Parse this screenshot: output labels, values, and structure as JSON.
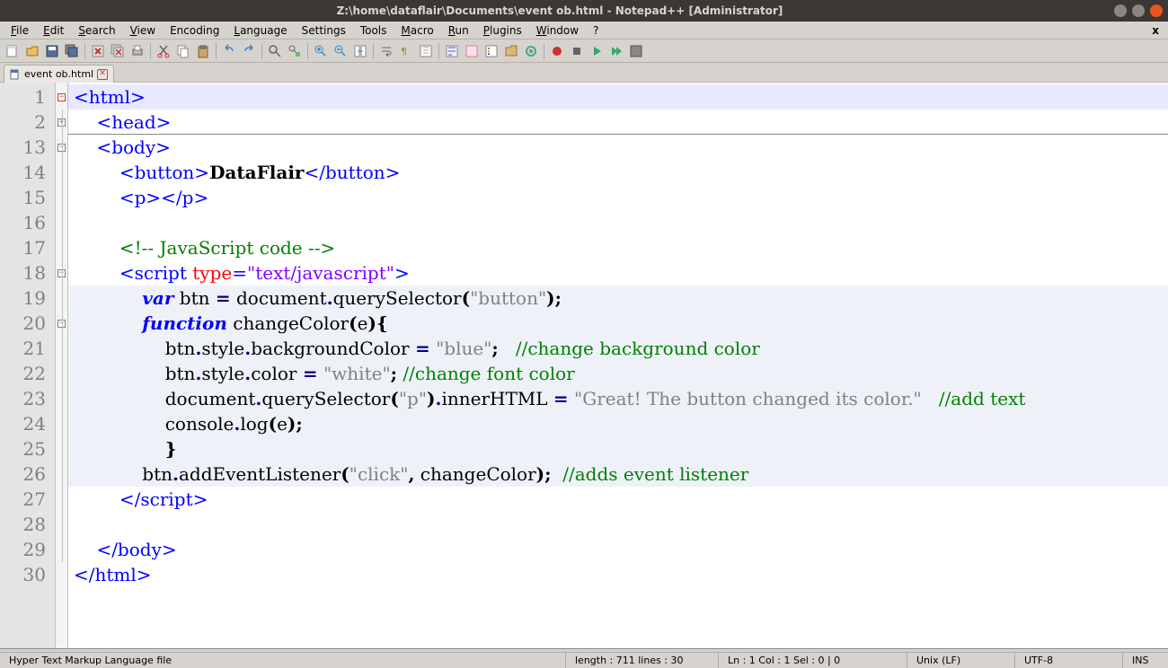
{
  "window": {
    "title": "Z:\\home\\dataflair\\Documents\\event ob.html - Notepad++ [Administrator]"
  },
  "menus": [
    "File",
    "Edit",
    "Search",
    "View",
    "Encoding",
    "Language",
    "Settings",
    "Tools",
    "Macro",
    "Run",
    "Plugins",
    "Window",
    "?"
  ],
  "menubar_close": "x",
  "tab": {
    "label": "event ob.html"
  },
  "line_numbers": [
    "1",
    "2",
    "13",
    "14",
    "15",
    "16",
    "17",
    "18",
    "19",
    "20",
    "21",
    "22",
    "23",
    "24",
    "25",
    "26",
    "27",
    "28",
    "29",
    "30"
  ],
  "fold_markers": [
    "-",
    "+",
    "-",
    "",
    "",
    "",
    "",
    "-",
    "",
    "-",
    "",
    "",
    "",
    "",
    "",
    "",
    "",
    "",
    "",
    ""
  ],
  "code": {
    "l1": {
      "indent": "",
      "t": [
        {
          "c": "tag",
          "v": "<html>"
        }
      ]
    },
    "l2": {
      "indent": "    ",
      "t": [
        {
          "c": "tag",
          "v": "<head>"
        }
      ]
    },
    "l3": {
      "indent": "    ",
      "t": [
        {
          "c": "tag",
          "v": "<body>"
        }
      ]
    },
    "l4": {
      "indent": "        ",
      "t": [
        {
          "c": "tag",
          "v": "<button>"
        },
        {
          "c": "bold",
          "v": "DataFlair"
        },
        {
          "c": "tag",
          "v": "</button>"
        }
      ]
    },
    "l5": {
      "indent": "        ",
      "t": [
        {
          "c": "tag",
          "v": "<p></p>"
        }
      ]
    },
    "l6": {
      "indent": "",
      "t": []
    },
    "l7": {
      "indent": "        ",
      "t": [
        {
          "c": "comment",
          "v": "<!-- JavaScript code -->"
        }
      ]
    },
    "l8": {
      "indent": "        ",
      "t": [
        {
          "c": "tag",
          "v": "<script "
        },
        {
          "c": "attr",
          "v": "type"
        },
        {
          "c": "tag",
          "v": "="
        },
        {
          "c": "str",
          "v": "\"text/javascript\""
        },
        {
          "c": "tag",
          "v": ">"
        }
      ]
    },
    "l9": {
      "indent": "            ",
      "t": [
        {
          "c": "kw",
          "v": "var"
        },
        {
          "c": "ident",
          "v": " btn "
        },
        {
          "c": "punct",
          "v": "="
        },
        {
          "c": "ident",
          "v": " document"
        },
        {
          "c": "punct",
          "v": "."
        },
        {
          "c": "ident",
          "v": "querySelector"
        },
        {
          "c": "paren",
          "v": "("
        },
        {
          "c": "strgray",
          "v": "\"button\""
        },
        {
          "c": "paren",
          "v": ");"
        }
      ]
    },
    "l10": {
      "indent": "            ",
      "t": [
        {
          "c": "kw",
          "v": "function"
        },
        {
          "c": "ident",
          "v": " changeColor"
        },
        {
          "c": "paren",
          "v": "("
        },
        {
          "c": "ident",
          "v": "e"
        },
        {
          "c": "paren",
          "v": "){"
        }
      ]
    },
    "l11": {
      "indent": "                ",
      "t": [
        {
          "c": "ident",
          "v": "btn"
        },
        {
          "c": "punct",
          "v": "."
        },
        {
          "c": "ident",
          "v": "style"
        },
        {
          "c": "punct",
          "v": "."
        },
        {
          "c": "ident",
          "v": "backgroundColor "
        },
        {
          "c": "punct",
          "v": "="
        },
        {
          "c": "ident",
          "v": " "
        },
        {
          "c": "strgray",
          "v": "\"blue\""
        },
        {
          "c": "paren",
          "v": ";"
        },
        {
          "c": "ident",
          "v": "   "
        },
        {
          "c": "comment",
          "v": "//change background color"
        }
      ]
    },
    "l12": {
      "indent": "                ",
      "t": [
        {
          "c": "ident",
          "v": "btn"
        },
        {
          "c": "punct",
          "v": "."
        },
        {
          "c": "ident",
          "v": "style"
        },
        {
          "c": "punct",
          "v": "."
        },
        {
          "c": "ident",
          "v": "color "
        },
        {
          "c": "punct",
          "v": "="
        },
        {
          "c": "ident",
          "v": " "
        },
        {
          "c": "strgray",
          "v": "\"white\""
        },
        {
          "c": "paren",
          "v": ";"
        },
        {
          "c": "ident",
          "v": " "
        },
        {
          "c": "comment",
          "v": "//change font color"
        }
      ]
    },
    "l13": {
      "indent": "                ",
      "t": [
        {
          "c": "ident",
          "v": "document"
        },
        {
          "c": "punct",
          "v": "."
        },
        {
          "c": "ident",
          "v": "querySelector"
        },
        {
          "c": "paren",
          "v": "("
        },
        {
          "c": "strgray",
          "v": "\"p\""
        },
        {
          "c": "paren",
          "v": ")"
        },
        {
          "c": "punct",
          "v": "."
        },
        {
          "c": "ident",
          "v": "innerHTML "
        },
        {
          "c": "punct",
          "v": "="
        },
        {
          "c": "ident",
          "v": " "
        },
        {
          "c": "strgray",
          "v": "\"Great! The button changed its color.\""
        },
        {
          "c": "ident",
          "v": "   "
        },
        {
          "c": "comment",
          "v": "//add text"
        }
      ]
    },
    "l14": {
      "indent": "                ",
      "t": [
        {
          "c": "ident",
          "v": "console"
        },
        {
          "c": "punct",
          "v": "."
        },
        {
          "c": "ident",
          "v": "log"
        },
        {
          "c": "paren",
          "v": "("
        },
        {
          "c": "ident",
          "v": "e"
        },
        {
          "c": "paren",
          "v": ");"
        }
      ]
    },
    "l15": {
      "indent": "                ",
      "t": [
        {
          "c": "paren",
          "v": "}"
        }
      ]
    },
    "l16": {
      "indent": "            ",
      "t": [
        {
          "c": "ident",
          "v": "btn"
        },
        {
          "c": "punct",
          "v": "."
        },
        {
          "c": "ident",
          "v": "addEventListener"
        },
        {
          "c": "paren",
          "v": "("
        },
        {
          "c": "strgray",
          "v": "\"click\""
        },
        {
          "c": "paren",
          "v": ","
        },
        {
          "c": "ident",
          "v": " changeColor"
        },
        {
          "c": "paren",
          "v": ");"
        },
        {
          "c": "ident",
          "v": "  "
        },
        {
          "c": "comment",
          "v": "//adds event listener"
        }
      ]
    },
    "l17": {
      "indent": "        ",
      "t": [
        {
          "c": "tag",
          "v": "</script>"
        }
      ]
    },
    "l18": {
      "indent": "",
      "t": []
    },
    "l19": {
      "indent": "    ",
      "t": [
        {
          "c": "tag",
          "v": "</body>"
        }
      ]
    },
    "l20": {
      "indent": "",
      "t": [
        {
          "c": "tag",
          "v": "</html>"
        }
      ]
    }
  },
  "statusbar": {
    "filetype": "Hyper Text Markup Language file",
    "length": "length : 711    lines : 30",
    "pos": "Ln : 1    Col : 1    Sel : 0 | 0",
    "eol": "Unix (LF)",
    "enc": "UTF-8",
    "ins": "INS"
  }
}
